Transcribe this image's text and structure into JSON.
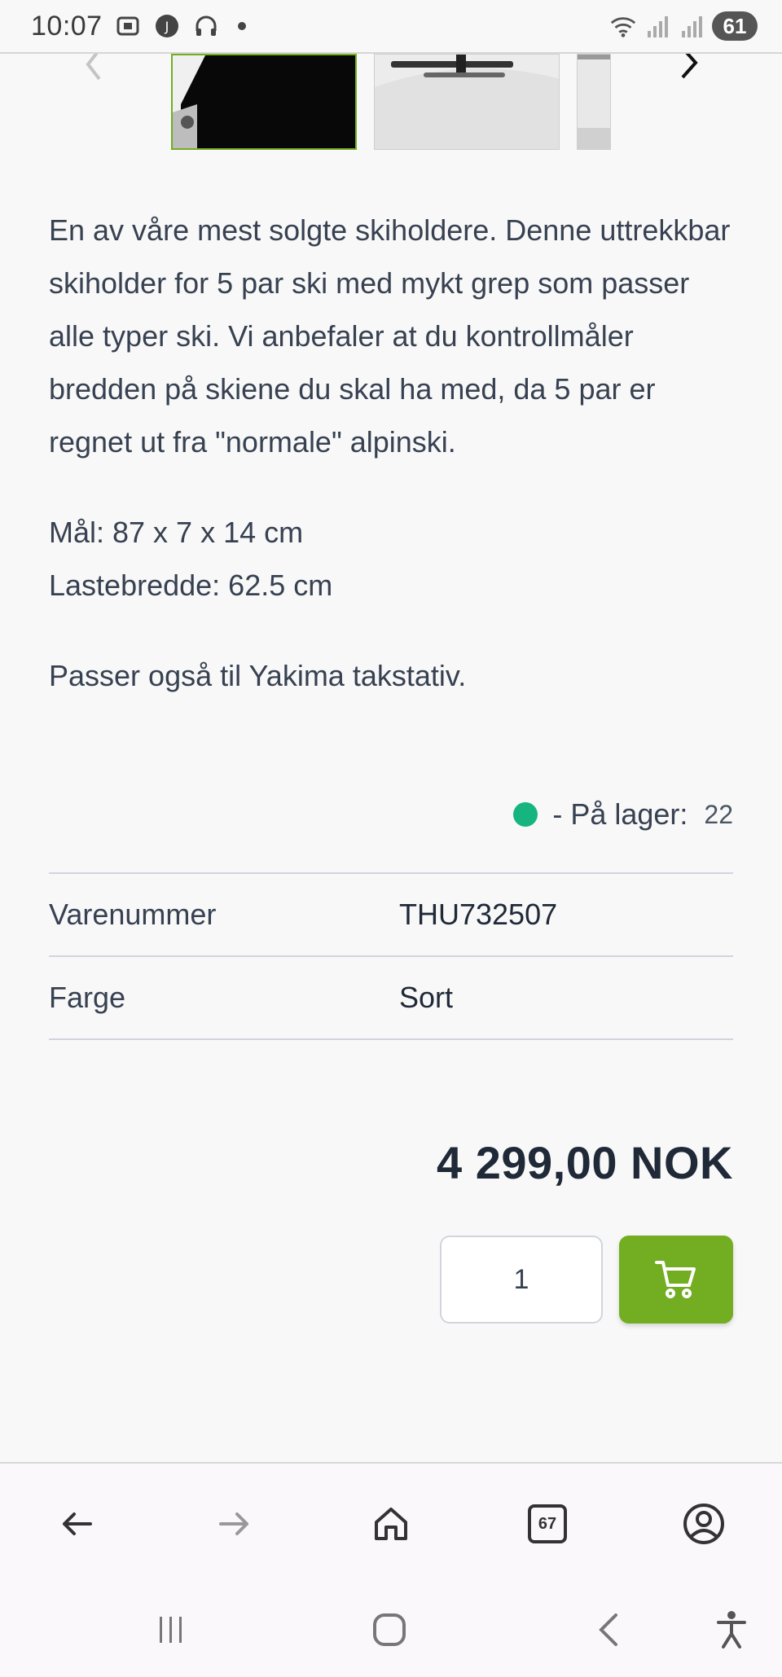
{
  "status_bar": {
    "time": "10:07",
    "battery": "61",
    "icons": [
      "screenshot-icon",
      "app-notification-icon",
      "headphones-icon",
      "wifi-icon",
      "signal-icon",
      "signal-icon-2"
    ]
  },
  "carousel": {
    "prev_icon": "chevron-left-icon",
    "next_icon": "chevron-right-icon",
    "thumbnails": [
      "thumbnail-1",
      "thumbnail-2",
      "thumbnail-3"
    ]
  },
  "product": {
    "description": "En av våre mest solgte skiholdere. Denne uttrekkbar skiholder for 5 par ski med mykt grep som passer alle typer ski. Vi anbefaler at du kontrollmåler bredden på skiene du skal ha med, da 5 par er regnet ut fra \"normale\" alpinski.",
    "dimensions": "Mål: 87 x 7 x 14 cm",
    "load_width": "Lastebredde: 62.5 cm",
    "compat": "Passer også til Yakima takstativ.",
    "stock_label": "- På lager:",
    "stock_qty": "22",
    "stock_color": "#16b57f",
    "specs": [
      {
        "key": "Varenummer",
        "value": "THU732507"
      },
      {
        "key": "Farge",
        "value": "Sort"
      }
    ],
    "price": "4 299,00 NOK",
    "quantity": "1",
    "accent": "#72ad22"
  },
  "browser_toolbar": {
    "tabs_count": "67",
    "icons": [
      "back-arrow-icon",
      "forward-arrow-icon",
      "home-icon",
      "tabs-icon",
      "account-icon"
    ]
  },
  "system_nav": {
    "icons": [
      "recent-apps-icon",
      "home-nav-icon",
      "back-nav-icon",
      "accessibility-icon"
    ]
  }
}
